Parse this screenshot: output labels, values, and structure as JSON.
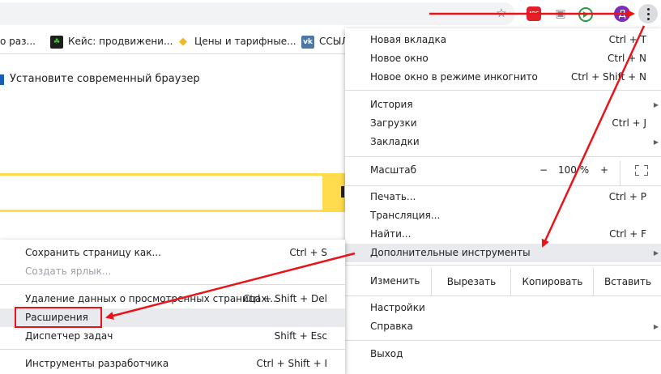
{
  "toolbar": {
    "avatar_letter": "Д",
    "adg_text": "ADG"
  },
  "bookmarks": [
    {
      "label": "о раз...",
      "icon": "bookmark-page-icon",
      "icon_color": "#5f6368"
    },
    {
      "label": "Кейс: продвижени...",
      "icon": "leaf-icon",
      "icon_color": "#1e8e3e"
    },
    {
      "label": "Цены и тарифные...",
      "icon": "duck-icon",
      "icon_color": "#f3b81f"
    },
    {
      "label": "ССЫЛ",
      "icon": "vk-icon",
      "icon_color": "#4a76a8"
    }
  ],
  "page": {
    "banner": "Установите современный браузер"
  },
  "main_menu": {
    "items": [
      {
        "label": "Новая вкладка",
        "shortcut": "Ctrl + T"
      },
      {
        "label": "Новое окно",
        "shortcut": "Ctrl + N"
      },
      {
        "label": "Новое окно в режиме инкогнито",
        "shortcut": "Ctrl + Shift + N"
      },
      {
        "label": "История",
        "shortcut": ""
      },
      {
        "label": "Загрузки",
        "shortcut": "Ctrl + J"
      },
      {
        "label": "Закладки",
        "shortcut": ""
      },
      {
        "label": "Печать...",
        "shortcut": "Ctrl + P"
      },
      {
        "label": "Трансляция...",
        "shortcut": ""
      },
      {
        "label": "Найти...",
        "shortcut": "Ctrl + F"
      },
      {
        "label": "Дополнительные инструменты",
        "shortcut": ""
      },
      {
        "label": "Настройки",
        "shortcut": ""
      },
      {
        "label": "Справка",
        "shortcut": ""
      },
      {
        "label": "Выход",
        "shortcut": ""
      }
    ],
    "zoom": {
      "label": "Масштаб",
      "minus": "−",
      "value": "100 %",
      "plus": "+"
    },
    "edit": {
      "label": "Изменить",
      "cut": "Вырезать",
      "copy": "Копировать",
      "paste": "Вставить"
    }
  },
  "sub_menu": {
    "items": [
      {
        "label": "Сохранить страницу как...",
        "shortcut": "Ctrl + S"
      },
      {
        "label": "Создать ярлык...",
        "shortcut": ""
      },
      {
        "label": "Удаление данных о просмотренных страницах...",
        "shortcut": "Ctrl + Shift + Del"
      },
      {
        "label": "Расширения",
        "shortcut": ""
      },
      {
        "label": "Диспетчер задач",
        "shortcut": "Shift + Esc"
      },
      {
        "label": "Инструменты разработчика",
        "shortcut": "Ctrl + Shift + I"
      }
    ]
  },
  "colors": {
    "accent_red": "#e8141a",
    "highlight": "#e8eaed",
    "yandex_yellow": "#ffdb4d"
  }
}
